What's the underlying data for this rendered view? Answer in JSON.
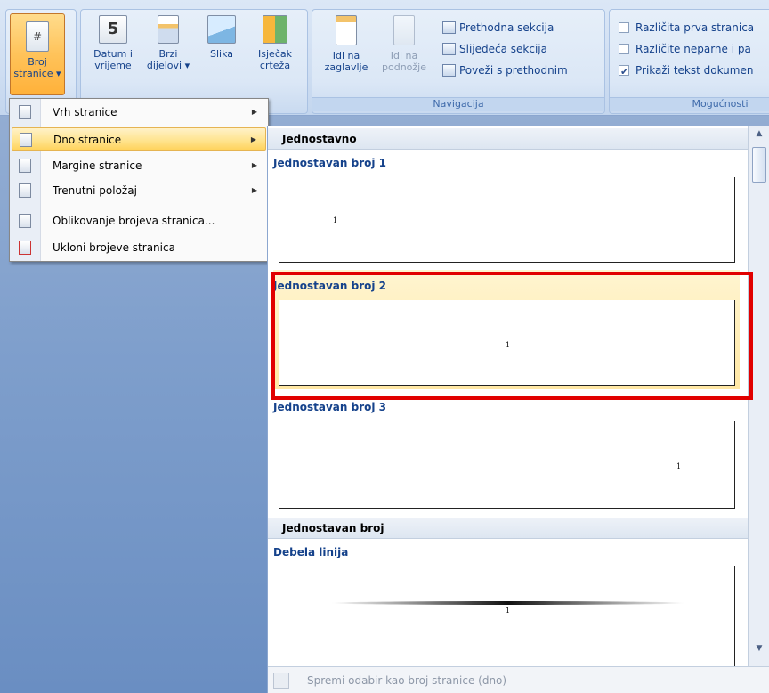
{
  "ribbon": {
    "header_footer": {
      "page_number": {
        "line1": "Broj",
        "line2": "stranice ▾"
      }
    },
    "insert": {
      "date_time": {
        "line1": "Datum i",
        "line2": "vrijeme"
      },
      "quick_parts": {
        "line1": "Brzi",
        "line2": "dijelovi ▾"
      },
      "picture": {
        "line1": "Slika"
      },
      "clip_art": {
        "line1": "Isječak",
        "line2": "crteža"
      }
    },
    "navigation": {
      "go_to_header": {
        "line1": "Idi na",
        "line2": "zaglavlje"
      },
      "go_to_footer": {
        "line1": "Idi na",
        "line2": "podnožje"
      },
      "previous_section": "Prethodna sekcija",
      "next_section": "Slijedeća sekcija",
      "link_to_previous": "Poveži s prethodnim",
      "label": "Navigacija"
    },
    "options": {
      "different_first_page": "Različita prva stranica",
      "different_odd_even": "Različite neparne i pa",
      "show_document_text": "Prikaži tekst dokumen",
      "label": "Mogućnosti"
    }
  },
  "menu": {
    "items": [
      {
        "label": "Vrh stranice",
        "icon": "page-top-icon",
        "submenu": true
      },
      {
        "label": "Dno stranice",
        "icon": "page-bottom-icon",
        "submenu": true,
        "hover": true
      },
      {
        "label": "Margine stranice",
        "icon": "page-margins-icon",
        "submenu": true
      },
      {
        "label": "Trenutni položaj",
        "icon": "current-position-icon",
        "submenu": true
      },
      {
        "label": "Oblikovanje brojeva stranica...",
        "icon": "format-page-numbers-icon",
        "submenu": false
      },
      {
        "label": "Ukloni brojeve stranica",
        "icon": "remove-page-numbers-icon",
        "submenu": false
      }
    ]
  },
  "gallery": {
    "section1_header": "Jednostavno",
    "items": [
      {
        "title": "Jednostavan broj 1",
        "number": "1",
        "align": "left"
      },
      {
        "title": "Jednostavan broj 2",
        "number": "1",
        "align": "center",
        "selected": true
      },
      {
        "title": "Jednostavan broj 3",
        "number": "1",
        "align": "right"
      }
    ],
    "section2_header": "Jednostavan broj",
    "thick_line": {
      "title": "Debela linija",
      "number": "1"
    },
    "footer_action": "Spremi odabir kao broj stranice (dno)"
  }
}
